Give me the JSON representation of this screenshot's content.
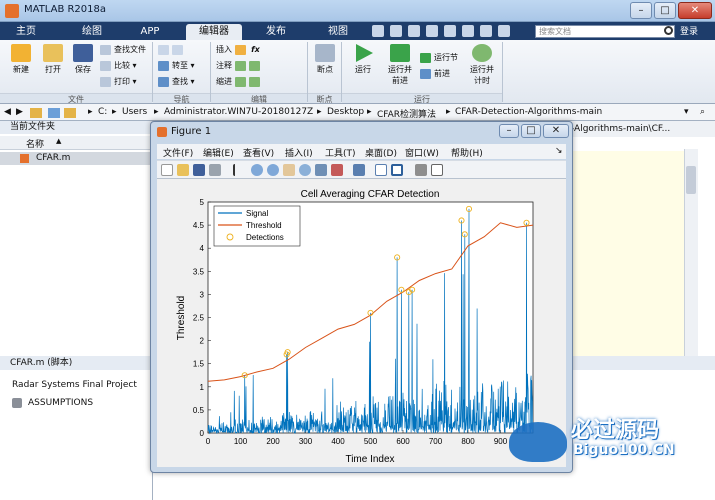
{
  "app": {
    "title": "MATLAB R2018a"
  },
  "tabs": [
    {
      "label": "主页",
      "active": false
    },
    {
      "label": "绘图",
      "active": false
    },
    {
      "label": "APP",
      "active": false
    },
    {
      "label": "编辑器",
      "active": true
    },
    {
      "label": "发布",
      "active": false
    },
    {
      "label": "视图",
      "active": false
    }
  ],
  "search": {
    "placeholder": "搜索文档"
  },
  "login_label": "登录",
  "ribbon": {
    "file": {
      "new": "新建",
      "open": "打开",
      "save": "保存",
      "find_files": "查找文件",
      "compare": "比较",
      "print": "打印",
      "section": "文件"
    },
    "navigate": {
      "goto": "转至",
      "find": "查找",
      "section": "导航"
    },
    "edit": {
      "insert": "插入",
      "comment": "注释",
      "indent": "缩进",
      "fx": "fx",
      "section": "编辑"
    },
    "breakpoints": {
      "label": "断点",
      "section": "断点"
    },
    "run": {
      "run": "运行",
      "run_advance": "运行并\n前进",
      "run_section": "运行节",
      "advance": "前进",
      "run_time": "运行并\n计时",
      "section": "运行"
    }
  },
  "address": {
    "crumbs": [
      "C:",
      "Users",
      "Administrator.WIN7U-20180127Z",
      "Desktop",
      "CFAR检测算法",
      "CFAR-Detection-Algorithms-main"
    ]
  },
  "left_pane": {
    "title": "当前文件夹",
    "col_name": "名称",
    "col_sort": "▲",
    "file": "CFAR.m"
  },
  "detail_pane": {
    "title": "CFAR.m (脚本)",
    "line1": "Radar Systems Final Project",
    "line2": "ASSUMPTIONS"
  },
  "editor": {
    "path_tail": "-Algorithms-main\\CF..."
  },
  "figure": {
    "title": "Figure 1",
    "menus": [
      "文件(F)",
      "编辑(E)",
      "查看(V)",
      "插入(I)",
      "工具(T)",
      "桌面(D)",
      "窗口(W)",
      "帮助(H)"
    ]
  },
  "chart_data": {
    "type": "line",
    "title": "Cell Averaging CFAR Detection",
    "xlabel": "Time Index",
    "ylabel": "Threshold",
    "xlim": [
      0,
      1000
    ],
    "ylim": [
      0,
      5
    ],
    "xticks": [
      0,
      100,
      200,
      300,
      400,
      500,
      600,
      700,
      800,
      900
    ],
    "yticks": [
      0,
      0.5,
      1,
      1.5,
      2,
      2.5,
      3,
      3.5,
      4,
      4.5,
      5
    ],
    "legend_position": "top-left",
    "series": [
      {
        "name": "Signal",
        "color": "#0072bd",
        "style": "line",
        "n": 1000,
        "baseline_max": 0.9
      },
      {
        "name": "Threshold",
        "color": "#d95319",
        "style": "line",
        "x": [
          0,
          50,
          100,
          150,
          200,
          250,
          300,
          350,
          400,
          450,
          500,
          550,
          600,
          650,
          700,
          750,
          800,
          850,
          900,
          950,
          1000
        ],
        "y": [
          1.12,
          1.15,
          1.22,
          1.32,
          1.4,
          1.6,
          1.85,
          2.05,
          2.25,
          2.35,
          2.55,
          2.85,
          3.05,
          3.3,
          3.45,
          3.55,
          4.05,
          4.25,
          4.55,
          4.45,
          4.5
        ]
      },
      {
        "name": "Detections",
        "color": "#edb120",
        "style": "marker",
        "x": [
          113,
          242,
          245,
          500,
          582,
          595,
          618,
          628,
          780,
          790,
          803,
          980
        ],
        "y": [
          1.25,
          1.7,
          1.75,
          2.6,
          3.8,
          3.1,
          3.05,
          3.1,
          4.6,
          4.3,
          4.85,
          4.55
        ]
      }
    ]
  },
  "watermark": {
    "brand": "必过源码",
    "url": "Biguo100.CN"
  }
}
